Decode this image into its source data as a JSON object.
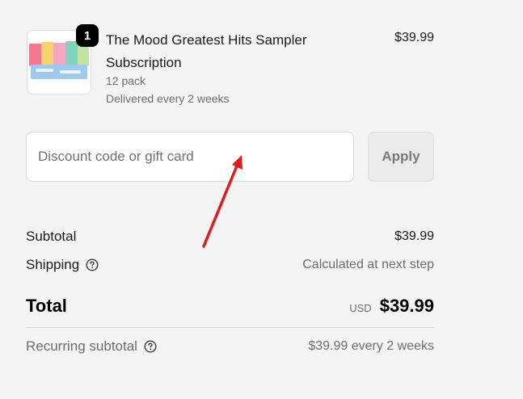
{
  "line_item": {
    "quantity": "1",
    "title": "The Mood Greatest Hits Sampler Subscription",
    "variant": "12 pack",
    "delivery": "Delivered every 2 weeks",
    "price": "$39.99",
    "thumbnail_colors": [
      "#f27a8f",
      "#f6d36b",
      "#7fd3c1",
      "#9fcaf0",
      "#c5e3a0"
    ]
  },
  "discount": {
    "placeholder": "Discount code or gift card",
    "value": "",
    "apply_label": "Apply"
  },
  "summary": {
    "subtotal_label": "Subtotal",
    "subtotal_value": "$39.99",
    "shipping_label": "Shipping",
    "shipping_value": "Calculated at next step",
    "total_label": "Total",
    "total_currency": "USD",
    "total_value": "$39.99",
    "recurring_label": "Recurring subtotal",
    "recurring_value": "$39.99 every 2 weeks"
  },
  "colors": {
    "annotation_arrow": "#e01b1b",
    "badge": "#000000",
    "background": "#f4f4f4"
  },
  "icons": {
    "help": "question-circle-icon",
    "annotation": "red-arrow-annotation"
  }
}
